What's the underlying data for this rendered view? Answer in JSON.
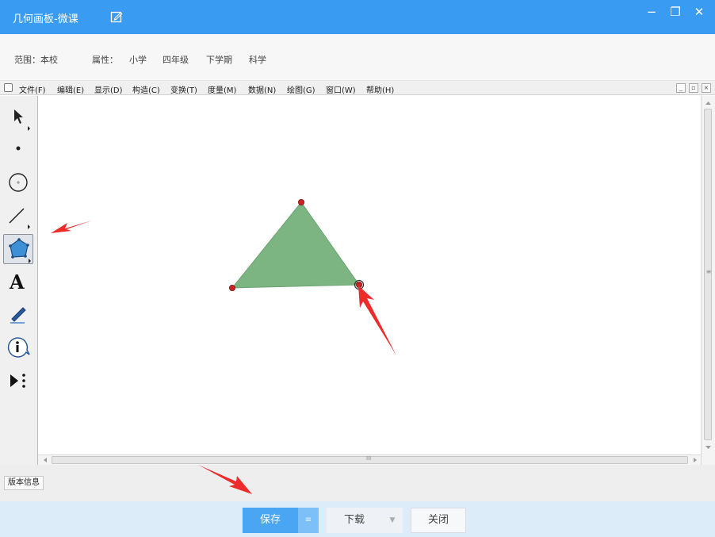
{
  "window": {
    "title": "几何画板-微课",
    "edit_icon": "edit-icon",
    "controls": {
      "minimize": "−",
      "restore": "❐",
      "close": "✕"
    }
  },
  "info": {
    "scope_label": "范围：本校",
    "attr_label": "属性：",
    "grade_1": "小学",
    "grade_2": "四年级",
    "term": "下学期",
    "subject": "科学"
  },
  "menu": {
    "items": [
      "文件(F)",
      "编辑(E)",
      "显示(D)",
      "构造(C)",
      "变换(T)",
      "度量(M)",
      "数据(N)",
      "绘图(G)",
      "窗口(W)",
      "帮助(H)"
    ],
    "mdi": {
      "minimize": "_",
      "restore": "▫",
      "close": "×"
    }
  },
  "toolbox": {
    "tools": [
      "arrow-select-icon",
      "point-icon",
      "compass-circle-icon",
      "straightedge-icon",
      "polygon-icon",
      "text-icon",
      "marker-icon",
      "information-icon",
      "custom-tool-icon"
    ],
    "active_tool": "polygon-icon",
    "text_tool_glyph": "A"
  },
  "canvas": {
    "polygon_fill": "#7db582",
    "vertex_color": "#cc2222",
    "annotation_arrow_color": "#ee2b2b"
  },
  "scroll": {
    "h_grip": "III",
    "v_grip": "≡"
  },
  "status": {
    "version_label": "版本信息"
  },
  "actions": {
    "save": "保存",
    "save_drop": "≡",
    "download": "下载",
    "download_drop": "▼",
    "close": "关闭",
    "accent": "#4aa6f3"
  }
}
